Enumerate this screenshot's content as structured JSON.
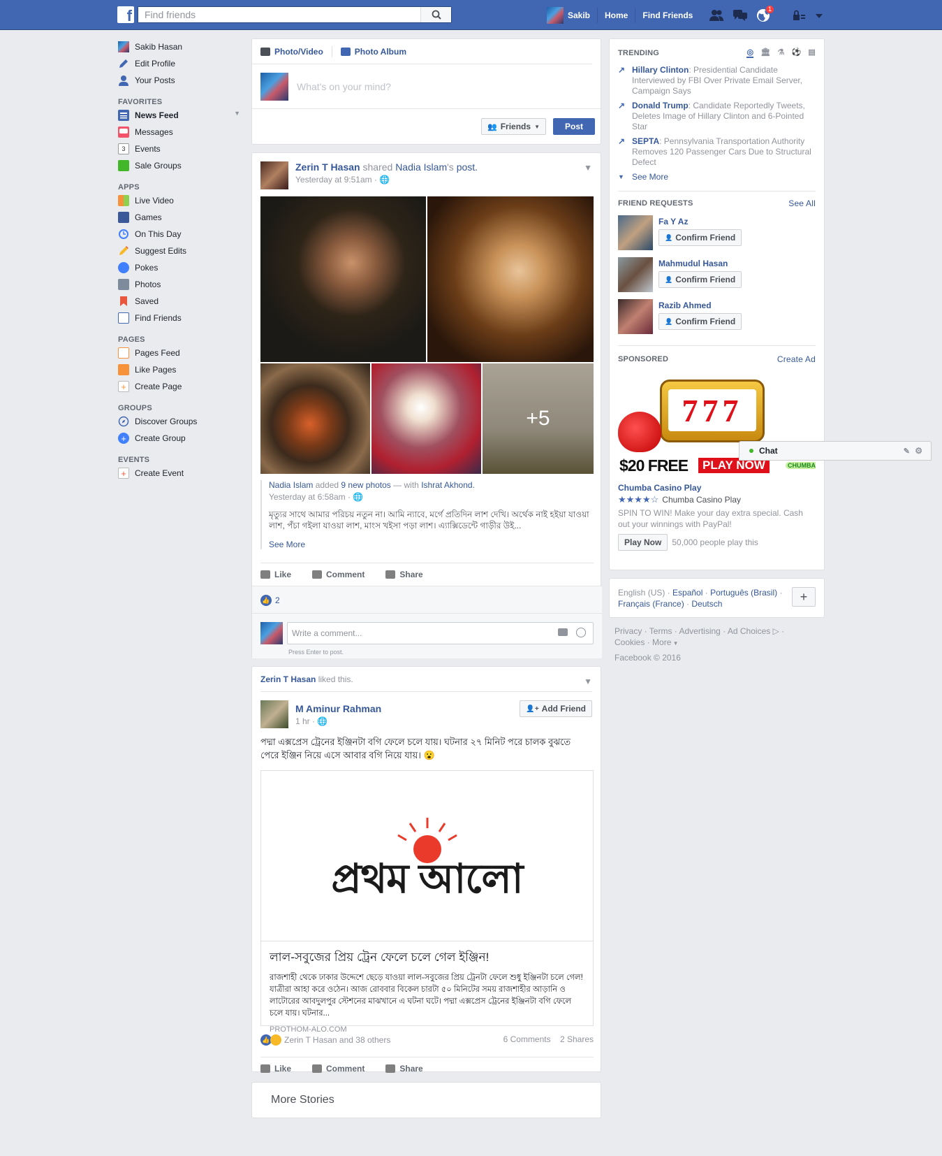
{
  "topbar": {
    "search_placeholder": "Find friends",
    "user_name": "Sakib",
    "home": "Home",
    "find_friends": "Find Friends",
    "notif_count": "1",
    "brand_color": "#4267b2"
  },
  "leftnav": {
    "profile": [
      {
        "label": "Sakib Hasan",
        "icon": "avatar"
      },
      {
        "label": "Edit Profile",
        "icon": "pencil-icon"
      },
      {
        "label": "Your Posts",
        "icon": "user-icon"
      }
    ],
    "favorites_header": "FAVORITES",
    "favorites": [
      {
        "label": "News Feed",
        "icon": "news-feed-icon"
      },
      {
        "label": "Messages",
        "icon": "messages-icon"
      },
      {
        "label": "Events",
        "icon": "calendar-icon",
        "icon_text": "3"
      },
      {
        "label": "Sale Groups",
        "icon": "tag-icon"
      }
    ],
    "apps_header": "APPS",
    "apps": [
      {
        "label": "Live Video",
        "icon": "live-video-icon"
      },
      {
        "label": "Games",
        "icon": "games-icon"
      },
      {
        "label": "On This Day",
        "icon": "clock-icon"
      },
      {
        "label": "Suggest Edits",
        "icon": "pencil-icon"
      },
      {
        "label": "Pokes",
        "icon": "poke-icon"
      },
      {
        "label": "Photos",
        "icon": "photos-icon"
      },
      {
        "label": "Saved",
        "icon": "bookmark-icon"
      },
      {
        "label": "Find Friends",
        "icon": "find-friends-icon"
      }
    ],
    "pages_header": "PAGES",
    "pages": [
      {
        "label": "Pages Feed",
        "icon": "pages-feed-icon"
      },
      {
        "label": "Like Pages",
        "icon": "like-pages-icon"
      },
      {
        "label": "Create Page",
        "icon": "plus-icon"
      }
    ],
    "groups_header": "GROUPS",
    "groups": [
      {
        "label": "Discover Groups",
        "icon": "compass-icon"
      },
      {
        "label": "Create Group",
        "icon": "plus-circle-icon"
      }
    ],
    "events_header": "EVENTS",
    "events": [
      {
        "label": "Create Event",
        "icon": "plus-icon"
      }
    ]
  },
  "composer": {
    "tab_photo": "Photo/Video",
    "tab_album": "Photo Album",
    "placeholder": "What's on your mind?",
    "audience": "Friends",
    "post": "Post"
  },
  "post1": {
    "author": "Zerin T Hasan",
    "shared": "shared",
    "shared_from": "Nadia Islam",
    "shared_suffix": "'s",
    "post_word": "post.",
    "time": "Yesterday at 9:51am",
    "more_count": "+5",
    "inner_author": "Nadia Islam",
    "inner_added": "added",
    "inner_photos": "9 new photos",
    "inner_with": "— with",
    "inner_tag": "Ishrat Akhond.",
    "inner_time": "Yesterday at 6:58am",
    "inner_text": "মৃত্যুর সাথে আমার পরিচয় নতুন না। আমি ন্যাবে, মর্গে প্রতিদিন লাশ দেখি। অর্থেক নাই হইয়া যাওয়া লাশ, পঁচা গইলা যাওয়া লাশ, মাংস খইসা পড়া লাশ। এ্যাক্সিডেন্টে গাড়ীর উই...",
    "see_more": "See More",
    "like": "Like",
    "comment": "Comment",
    "share": "Share",
    "like_count": "2",
    "comment_placeholder": "Write a comment...",
    "press_enter": "Press Enter to post."
  },
  "post2": {
    "liked_by": "Zerin T Hasan",
    "liked_this": "liked this.",
    "author": "M Aminur Rahman",
    "time": "1 hr",
    "add_friend": "Add Friend",
    "text": "পদ্মা এক্সপ্রেস ট্রেনের ইঞ্জিনটা বগি ফেলে চলে যায়। ঘটনার ২৭ মিনিট পরে চালক বুঝতে পেরে ইঞ্জিন নিয়ে এসে আবার বগি নিয়ে যায়। 😮",
    "logo_text": "প্রথম আলো",
    "link_title": "লাল-সবুজের প্রিয় ট্রেন ফেলে চলে গেল ইঞ্জিন!",
    "link_desc": "রাজশাহী থেকে ঢাকার উদ্দেশে ছেড়ে যাওয়া লাল-সবুজের প্রিয় ট্রেনটা ফেলে শুধু ইঞ্জিনটা চলে গেল! যাত্রীরা আহা করে ওঠেন। আজ রোববার বিকেল চারটা ৫০ মিনিটের সময় রাজশাহীর আড়ানি ও লাটোরের আবদুলপুর স্টেশনের মাঝখানে এ ঘটনা ঘটে। পদ্মা এক্সপ্রেস ট্রেনের ইঞ্জিনটা বগি ফেলে চলে যায়। ঘটনার...",
    "link_src": "PROTHOM-ALO.COM",
    "reactors": "Zerin T Hasan and 38 others",
    "comments": "6 Comments",
    "shares": "2 Shares",
    "like": "Like",
    "comment": "Comment",
    "share": "Share"
  },
  "more_stories": "More Stories",
  "trending": {
    "header": "TRENDING",
    "items": [
      {
        "name": "Hillary Clinton",
        "text": ": Presidential Candidate Interviewed by FBI Over Private Email Server, Campaign Says"
      },
      {
        "name": "Donald Trump",
        "text": ": Candidate Reportedly Tweets, Deletes Image of Hillary Clinton and 6-Pointed Star"
      },
      {
        "name": "SEPTA",
        "text": ": Pennsylvania Transportation Authority Removes 120 Passenger Cars Due to Structural Defect"
      }
    ],
    "see_more": "See More"
  },
  "friend_requests": {
    "header": "FRIEND REQUESTS",
    "see_all": "See All",
    "items": [
      {
        "name": "Fa Y Az",
        "button": "Confirm Friend"
      },
      {
        "name": "Mahmudul Hasan",
        "button": "Confirm Friend"
      },
      {
        "name": "Razib Ahmed",
        "button": "Confirm Friend"
      }
    ]
  },
  "sponsored": {
    "header": "SPONSORED",
    "create_ad": "Create Ad",
    "ad_reels": "777",
    "ad_free": "$20 FREE",
    "ad_play": "PLAY NOW",
    "ad_brand": "CHUMBA",
    "title": "Chumba Casino Play",
    "rating_label": "Chumba Casino Play",
    "rating": 4,
    "desc": "SPIN TO WIN! Make your day extra special. Cash out your winnings with PayPal!",
    "play_now": "Play Now",
    "players": "50,000 people play this"
  },
  "languages": {
    "current": "English (US)",
    "others": [
      "Español",
      "Português (Brasil)",
      "Français (France)",
      "Deutsch"
    ]
  },
  "footer": {
    "links": [
      "Privacy",
      "Terms",
      "Advertising",
      "Ad Choices",
      "Cookies",
      "More"
    ],
    "copyright": "Facebook © 2016"
  },
  "chat": {
    "label": "Chat"
  }
}
